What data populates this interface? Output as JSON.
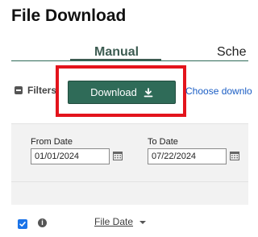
{
  "header": {
    "title": "File Download"
  },
  "tabs": [
    {
      "label": "Manual",
      "active": true
    },
    {
      "label": "Sche",
      "active": false
    }
  ],
  "filters": {
    "label": "Filters",
    "download_label": "Download",
    "choose_link": "Choose downlo"
  },
  "dates": {
    "from_label": "From Date",
    "from_value": "01/01/2024",
    "to_label": "To Date",
    "to_value": "07/22/2024"
  },
  "table": {
    "header_checkbox_checked": true,
    "column_file_date": "File Date"
  },
  "icons": {
    "download": "download-icon",
    "calendar": "calendar-icon",
    "info": "info-icon",
    "collapse": "minus-icon",
    "sort": "caret-down-icon"
  },
  "colors": {
    "accent": "#2f6b58",
    "highlight": "#e3141c",
    "link": "#1a5dc4",
    "checkbox": "#1a73e8"
  }
}
